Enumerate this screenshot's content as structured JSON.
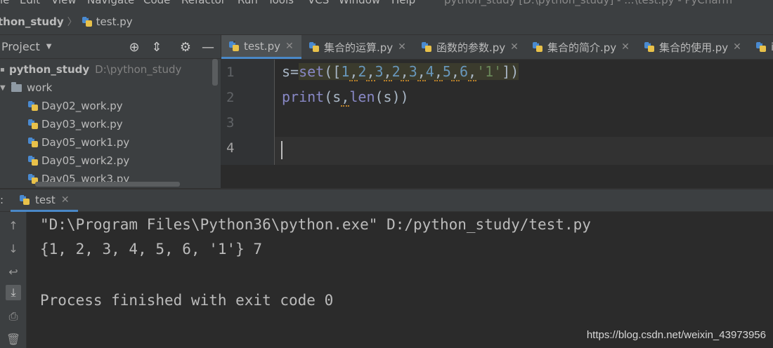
{
  "menu": {
    "items": [
      "le",
      "Edit",
      "View",
      "Navigate",
      "Code",
      "Refactor",
      "Run",
      "Tools",
      "VCS",
      "Window",
      "Help"
    ],
    "window_title": "python_study [D:\\python_study] - ...\\test.py - PyCharm"
  },
  "breadcrumb": {
    "project": "thon_study",
    "file": "test.py"
  },
  "project_panel": {
    "title": "Project",
    "tree": {
      "root_name": "python_study",
      "root_path": "D:\\python_study",
      "folder": "work",
      "files": [
        "Day02_work.py",
        "Day03_work.py",
        "Day05_work1.py",
        "Day05_work2.py",
        "Day05_work3.py"
      ]
    }
  },
  "editor": {
    "tabs": [
      "test.py",
      "集合的运算.py",
      "函数的参数.py",
      "集合的简介.py",
      "集合的使用.py",
      "i"
    ],
    "active_tab": "test.py",
    "line_numbers": [
      "1",
      "2",
      "3",
      "4"
    ],
    "lines": [
      "s=set([1,2,3,2,3,4,5,6,'1'])",
      "print(s,len(s))",
      "",
      ""
    ]
  },
  "run": {
    "label": ":",
    "tab": "test",
    "output": [
      "\"D:\\Program Files\\Python36\\python.exe\" D:/python_study/test.py",
      "{1, 2, 3, 4, 5, 6, '1'} 7",
      "",
      "Process finished with exit code 0"
    ]
  },
  "watermark": "https://blog.csdn.net/weixin_43973956",
  "colors": {
    "background": "#2b2b2b",
    "panel": "#3c3f41",
    "accent": "#4a88c7",
    "keyword_builtin": "#8888c6",
    "number": "#6897bb",
    "string": "#6a8759"
  }
}
